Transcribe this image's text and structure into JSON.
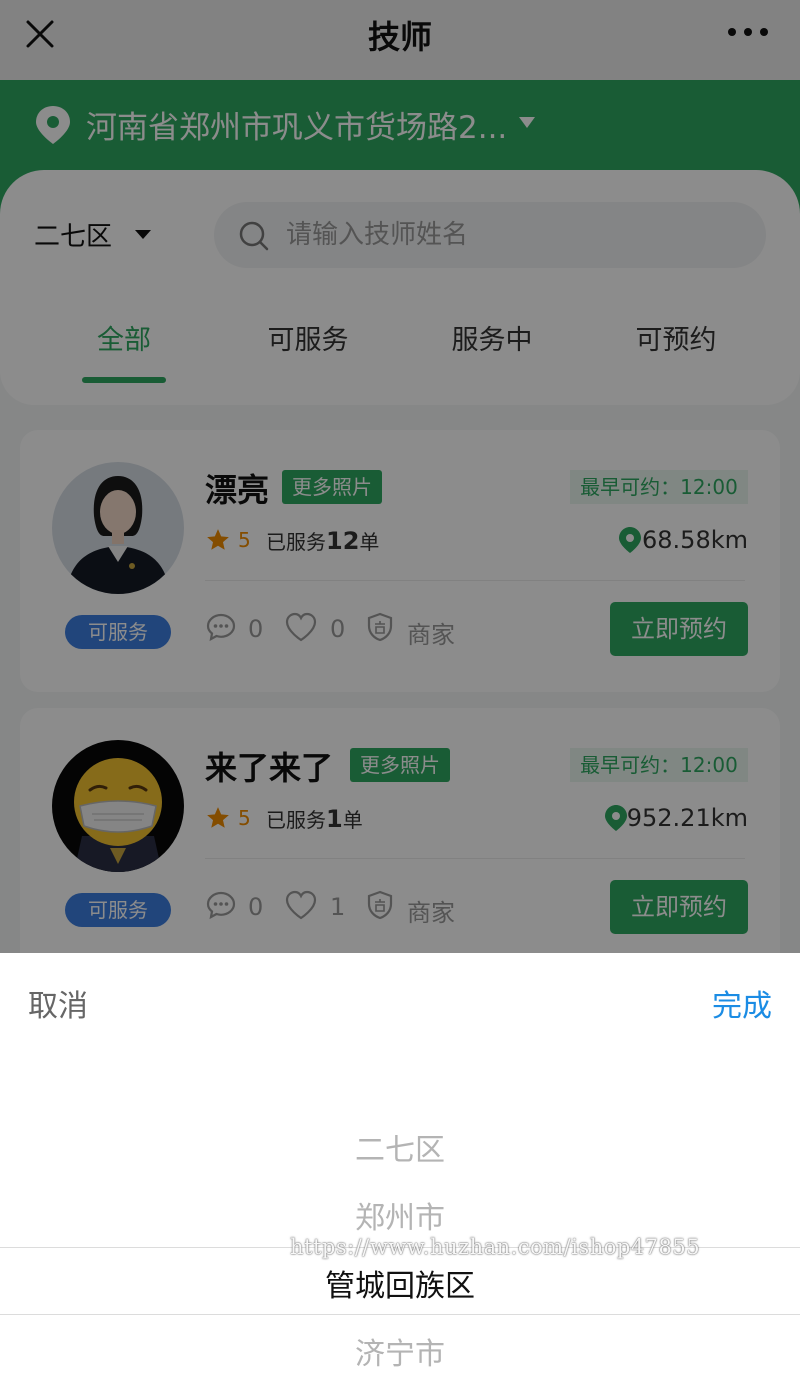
{
  "window": {
    "title": "技师"
  },
  "location": {
    "address": "河南省郑州市巩义市货场路2..."
  },
  "filter": {
    "district": "二七区",
    "search_placeholder": "请输入技师姓名"
  },
  "tabs": [
    {
      "label": "全部",
      "active": true
    },
    {
      "label": "可服务",
      "active": false
    },
    {
      "label": "服务中",
      "active": false
    },
    {
      "label": "可预约",
      "active": false
    }
  ],
  "technicians": [
    {
      "name": "漂亮",
      "more_photos": "更多照片",
      "earliest": "最早可约：12:00",
      "rating": "5",
      "served_prefix": "已服务",
      "served_count": "12",
      "served_unit": "单",
      "distance": "68.58km",
      "status": "可服务",
      "comments": "0",
      "likes": "0",
      "merchant": "商家",
      "book": "立即预约"
    },
    {
      "name": "来了来了",
      "more_photos": "更多照片",
      "earliest": "最早可约：12:00",
      "rating": "5",
      "served_prefix": "已服务",
      "served_count": "1",
      "served_unit": "单",
      "distance": "952.21km",
      "status": "可服务",
      "comments": "0",
      "likes": "1",
      "merchant": "商家",
      "book": "立即预约"
    }
  ],
  "picker": {
    "cancel": "取消",
    "done": "完成",
    "options": [
      "二七区",
      "郑州市",
      "管城回族区",
      "济宁市"
    ],
    "selected": "管城回族区"
  },
  "watermark": "https://www.huzhan.com/ishop47855",
  "icons": {
    "close": "close-icon",
    "more": "more-icon",
    "location": "location-pin-icon",
    "search": "search-icon",
    "star": "star-icon",
    "comment": "comment-icon",
    "heart": "heart-icon",
    "merchant": "shield-icon"
  },
  "colors": {
    "brand": "#2fa862",
    "status_badge": "#3c7ee0",
    "rating": "#f08c00",
    "done": "#1b8ce4"
  }
}
